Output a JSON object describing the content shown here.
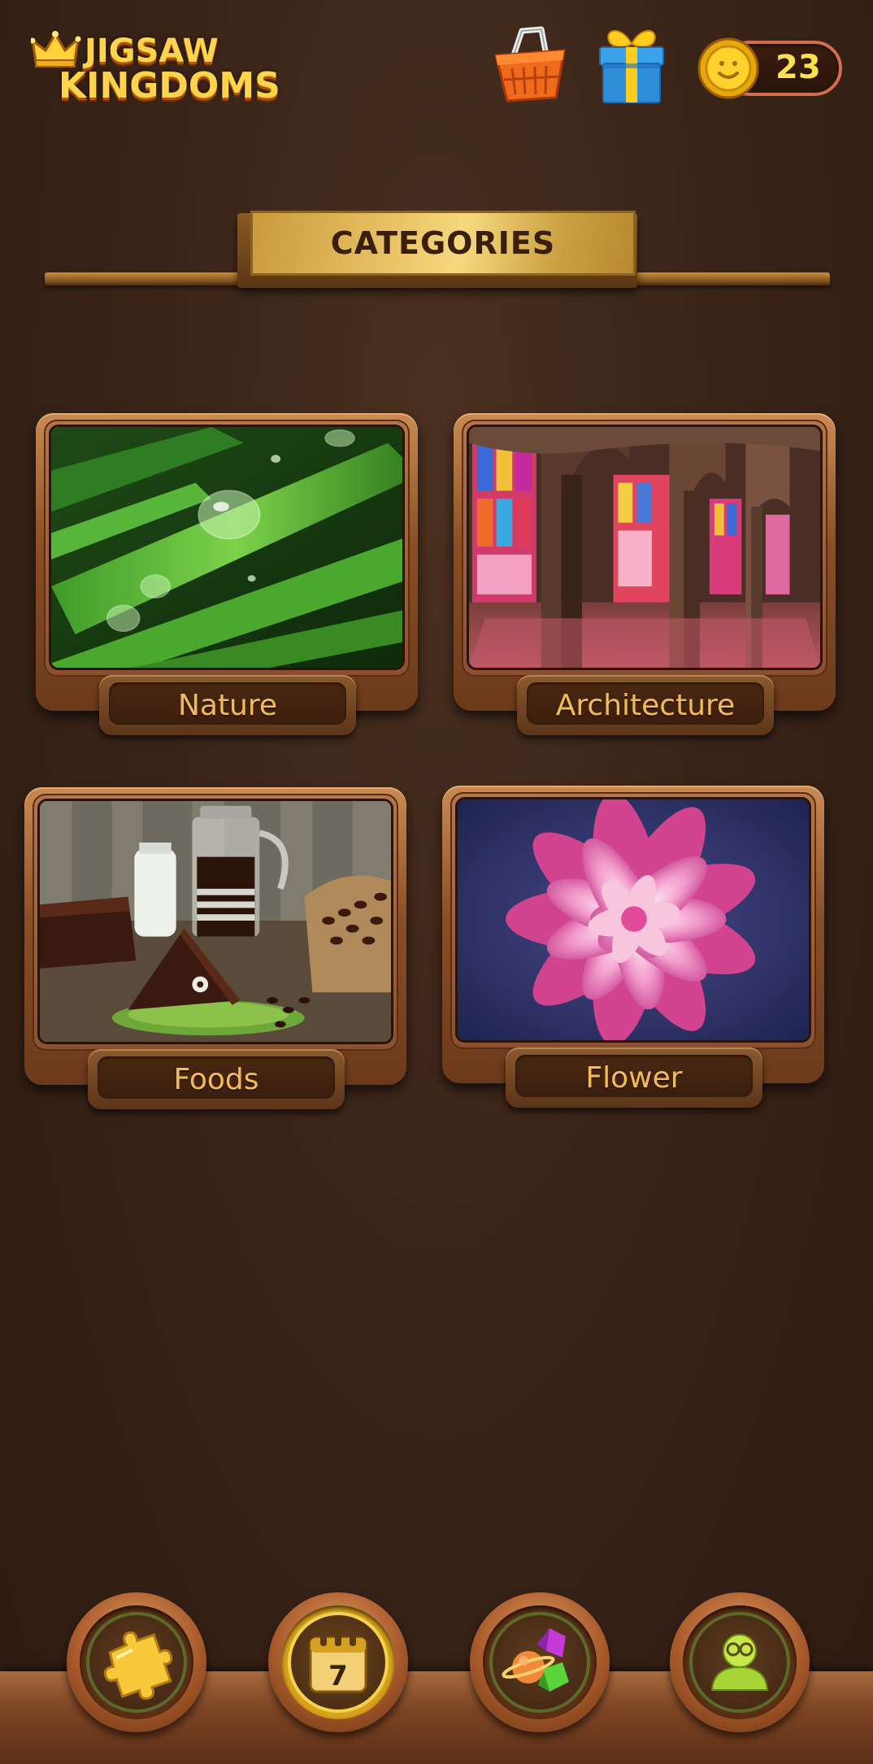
{
  "header": {
    "logo_line1": "JIGSAW",
    "logo_line2": "KINGDOMS",
    "coins": "23",
    "icons": [
      "crown-icon",
      "shop-basket-icon",
      "gift-box-icon",
      "coin-icon"
    ]
  },
  "categories_title": "CATEGORIES",
  "categories": [
    {
      "label": "Nature",
      "image": "grass with water drops"
    },
    {
      "label": "Architecture",
      "image": "stained glass mosque interior"
    },
    {
      "label": "Foods",
      "image": "chocolate cake and coffee"
    },
    {
      "label": "Flower",
      "image": "pink dahlia"
    }
  ],
  "bottom_nav": [
    {
      "icon": "puzzle-piece-icon",
      "active": false
    },
    {
      "icon": "daily-calendar-icon",
      "active": true,
      "badge": "7"
    },
    {
      "icon": "planet-shapes-icon",
      "active": false
    },
    {
      "icon": "profile-avatar-icon",
      "active": false
    }
  ],
  "colors": {
    "background": "#3a2418",
    "gold": "#ffd44d",
    "label_text": "#f1bc58",
    "frame": "#8a4e26"
  }
}
